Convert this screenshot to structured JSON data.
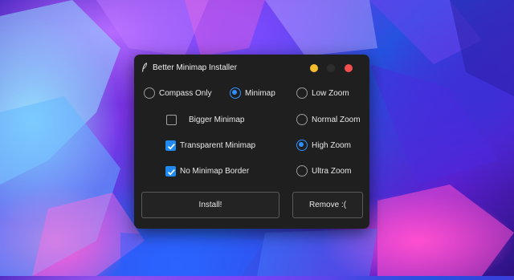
{
  "window": {
    "title": "Better Minimap Installer",
    "icon": "feather-icon",
    "controls": {
      "minimize_color": "#f6be2f",
      "maximize_color": "#2d2d2d",
      "close_color": "#f34e4e"
    }
  },
  "mode": {
    "compass_only": {
      "label": "Compass Only",
      "selected": false
    },
    "minimap": {
      "label": "Minimap",
      "selected": true
    }
  },
  "options": {
    "bigger_minimap": {
      "label": "Bigger  Minimap",
      "checked": false
    },
    "transparent_minimap": {
      "label": "Transparent Minimap",
      "checked": true
    },
    "no_minimap_border": {
      "label": "No  Minimap  Border",
      "checked": true
    }
  },
  "zoom": {
    "low": {
      "label": "Low Zoom",
      "selected": false
    },
    "normal": {
      "label": "Normal Zoom",
      "selected": false
    },
    "high": {
      "label": "High Zoom",
      "selected": true
    },
    "ultra": {
      "label": "Ultra Zoom",
      "selected": false
    }
  },
  "buttons": {
    "install": "Install!",
    "remove": "Remove :("
  },
  "colors": {
    "accent": "#2f8fff",
    "window_bg": "#1f1f1f"
  }
}
